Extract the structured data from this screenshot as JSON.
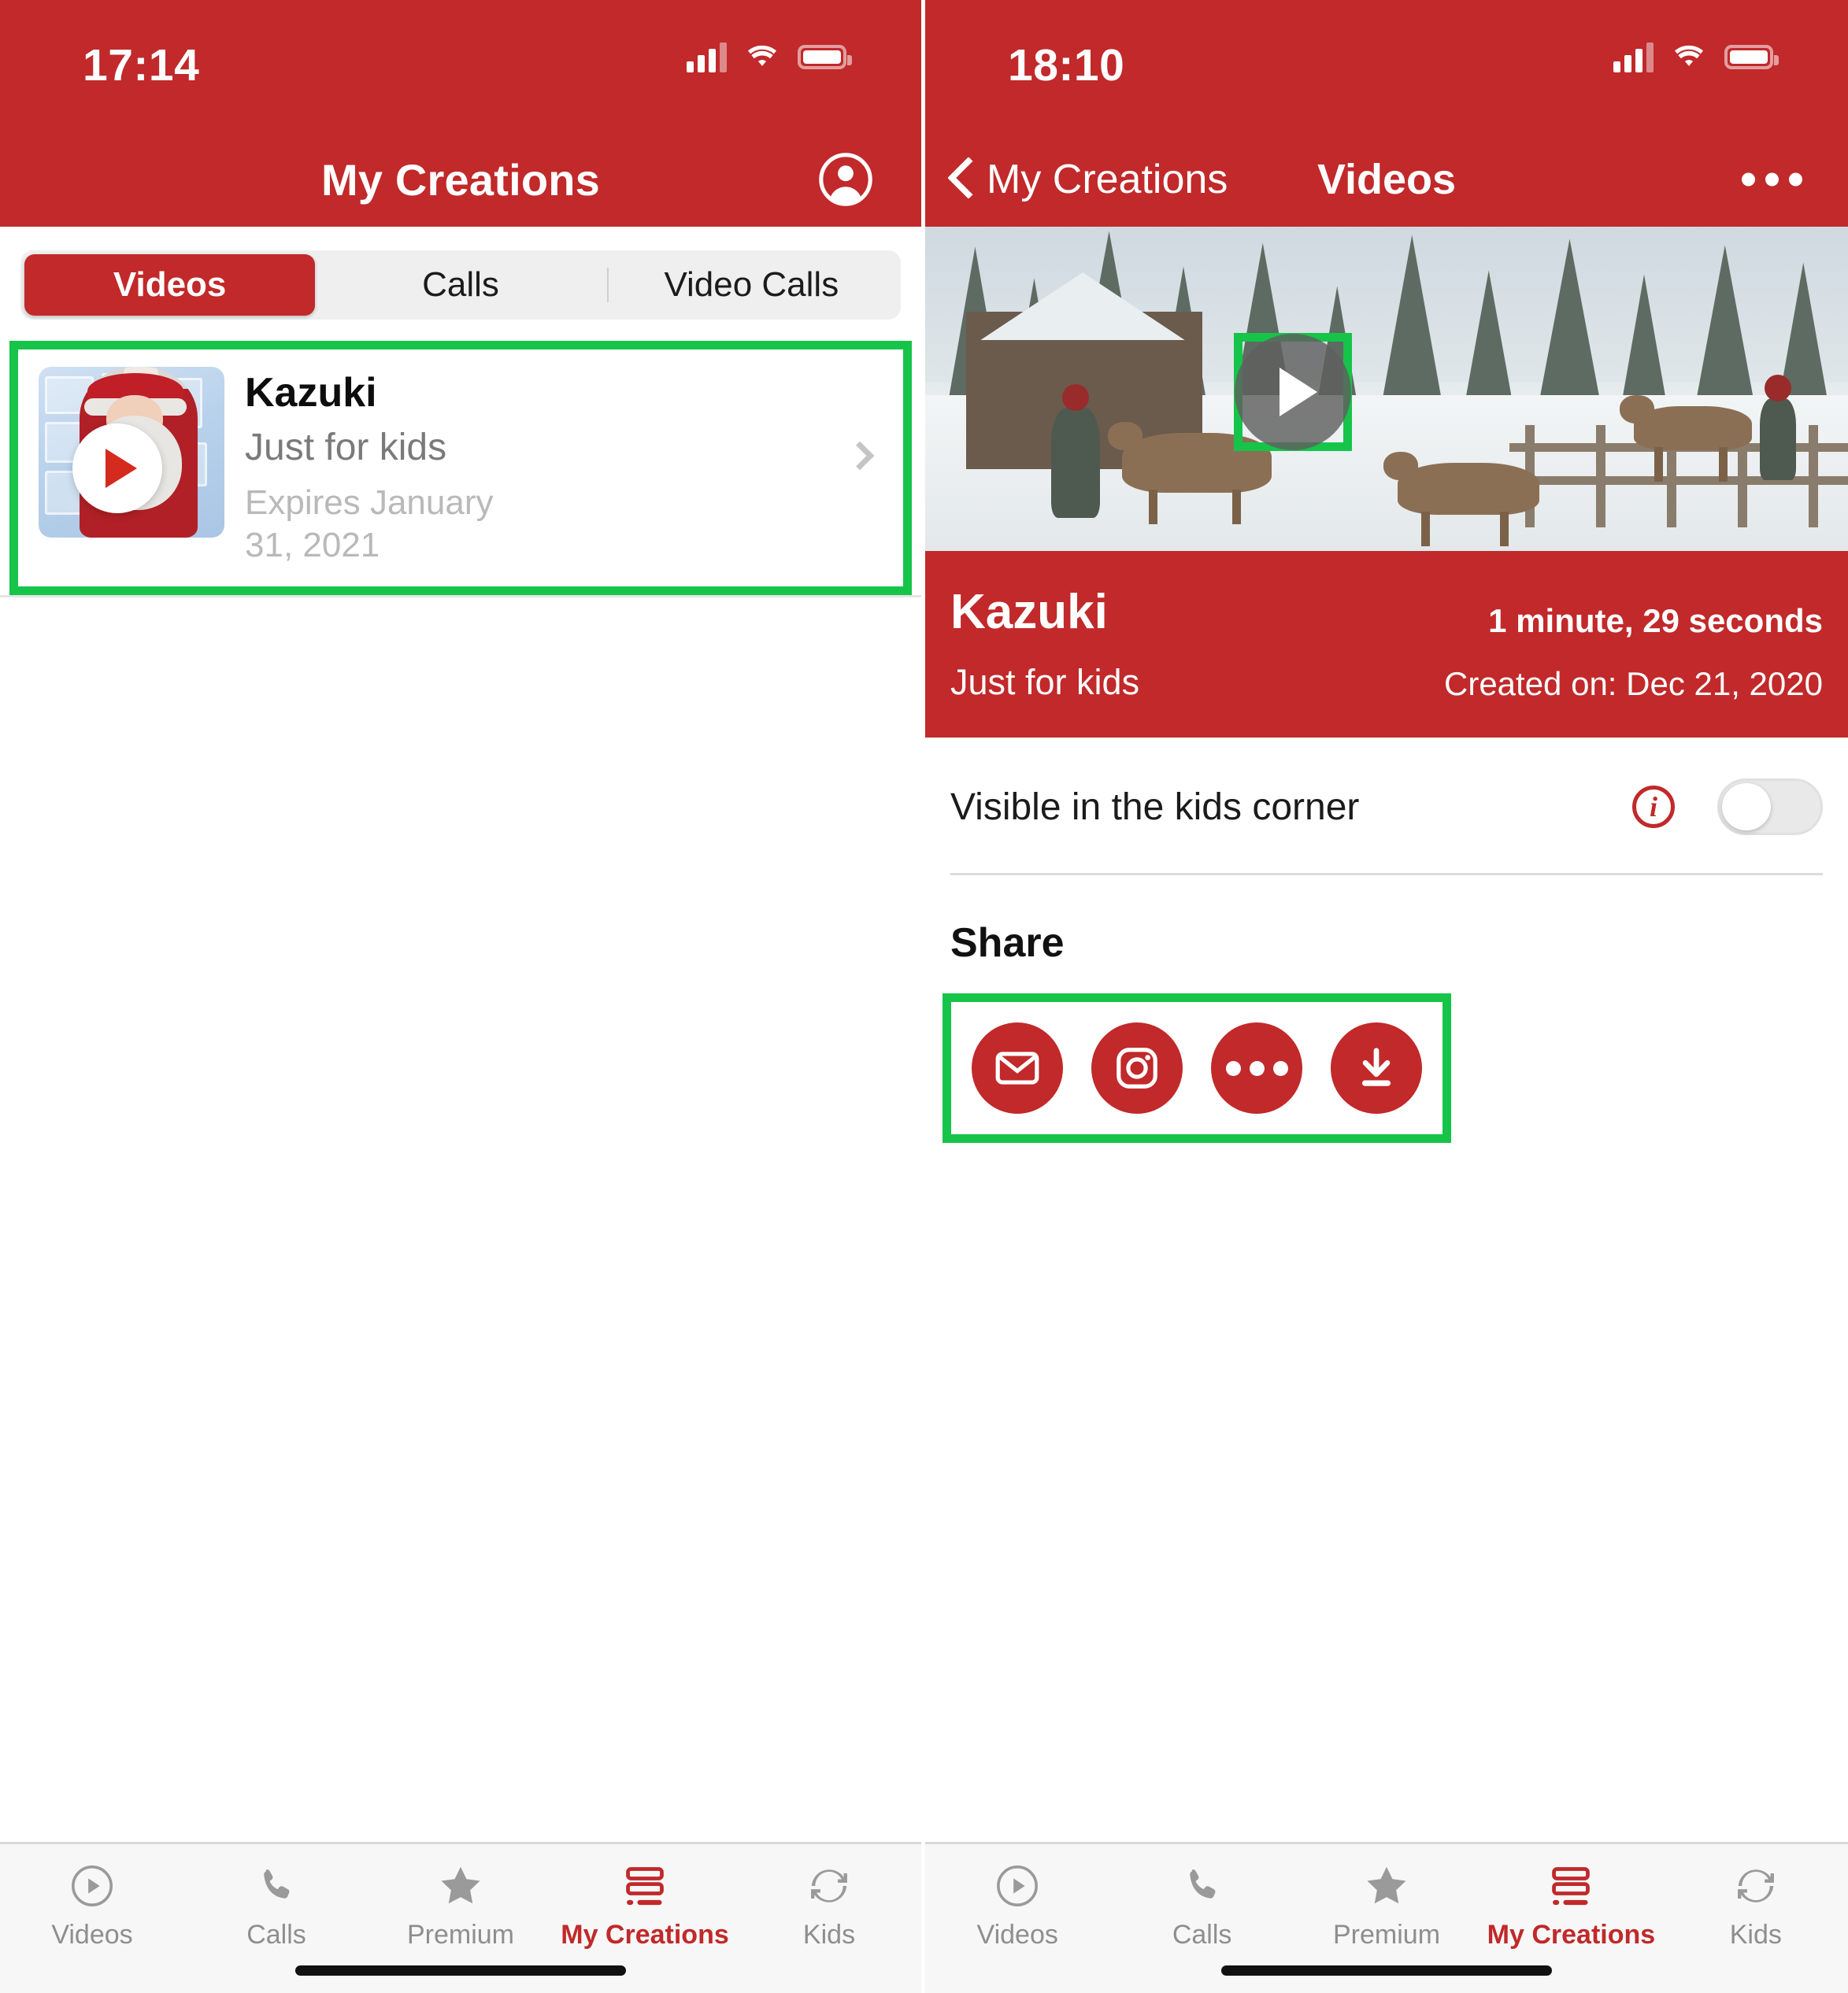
{
  "left": {
    "status": {
      "time": "17:14",
      "signal_icon": "cellular-signal-icon",
      "wifi_icon": "wifi-icon",
      "battery_icon": "battery-icon"
    },
    "nav": {
      "title": "My Creations",
      "account_icon": "account-circle-icon"
    },
    "tabs": [
      {
        "label": "Videos",
        "active": true
      },
      {
        "label": "Calls",
        "active": false
      },
      {
        "label": "Video Calls",
        "active": false
      }
    ],
    "video_card": {
      "title": "Kazuki",
      "subtitle": "Just for kids",
      "expiry": "Expires January 31, 2021",
      "play_icon": "play-icon",
      "chevron_icon": "chevron-right-icon",
      "thumbnail_alt": "santa-claus-thumbnail",
      "highlighted": true
    }
  },
  "right": {
    "status": {
      "time": "18:10",
      "signal_icon": "cellular-signal-icon",
      "wifi_icon": "wifi-icon",
      "battery_icon": "battery-icon"
    },
    "nav": {
      "back_label": "My Creations",
      "back_icon": "chevron-left-icon",
      "title": "Videos",
      "more_icon": "more-horizontal-icon"
    },
    "hero": {
      "play_icon": "play-icon",
      "highlighted": true,
      "scene_alt": "snowy-reindeer-village-video-frame"
    },
    "info": {
      "title": "Kazuki",
      "duration": "1 minute, 29 seconds",
      "subtitle": "Just for kids",
      "created": "Created on: Dec 21, 2020"
    },
    "visibility": {
      "label": "Visible in the kids corner",
      "info_icon": "info-circle-icon",
      "toggle_icon": "toggle-switch-off",
      "toggle_on": false
    },
    "share": {
      "heading": "Share",
      "highlighted": true,
      "buttons": [
        {
          "name": "email-share-button",
          "icon": "envelope-icon"
        },
        {
          "name": "instagram-share-button",
          "icon": "instagram-icon"
        },
        {
          "name": "more-share-button",
          "icon": "more-dots-icon"
        },
        {
          "name": "download-button",
          "icon": "download-icon"
        }
      ]
    }
  },
  "tabbar": [
    {
      "label": "Videos",
      "icon": "play-circle-icon",
      "active": false
    },
    {
      "label": "Calls",
      "icon": "phone-icon",
      "active": false
    },
    {
      "label": "Premium",
      "icon": "star-icon",
      "active": false
    },
    {
      "label": "My Creations",
      "icon": "my-creations-icon",
      "active": true
    },
    {
      "label": "Kids",
      "icon": "refresh-icon",
      "active": false
    }
  ],
  "colors": {
    "brand_red": "#c1292a",
    "highlight_green": "#16c44a",
    "muted_gray": "#8e8e8e",
    "play_red": "#d52b1e"
  }
}
